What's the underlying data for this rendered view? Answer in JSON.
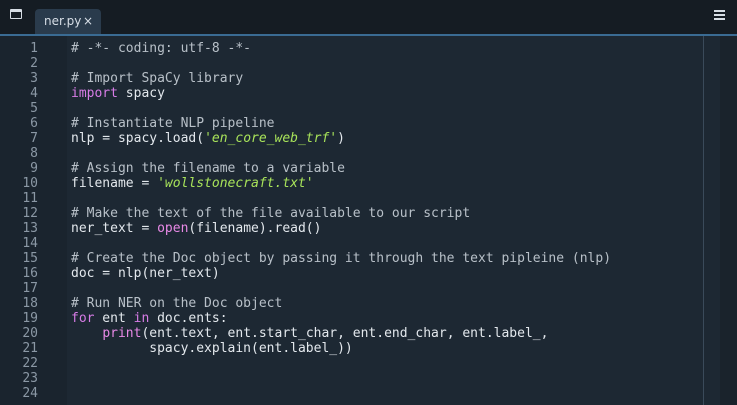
{
  "tab": {
    "filename": "ner.py",
    "close_glyph": "×"
  },
  "icons": {
    "window": "window-icon",
    "menu": "hamburger-menu-icon",
    "close": "close-icon"
  },
  "colors": {
    "background": "#1d2833",
    "comment": "#b8c0c8",
    "keyword": "#d77ce6",
    "string": "#a8e35a",
    "accent": "#3a6b93"
  },
  "line_numbers": [
    "1",
    "2",
    "3",
    "4",
    "5",
    "6",
    "7",
    "8",
    "9",
    "10",
    "11",
    "12",
    "13",
    "14",
    "15",
    "16",
    "17",
    "18",
    "19",
    "20",
    "21",
    "22",
    "23",
    "24"
  ],
  "code": {
    "l1": "# -*- coding: utf-8 -*-",
    "l3": "# Import SpaCy library",
    "l4_kw": "import",
    "l4_rest": " spacy",
    "l6": "# Instantiate NLP pipeline",
    "l7_a": "nlp = spacy.load(",
    "l7_str": "'en_core_web_trf'",
    "l7_b": ")",
    "l9": "# Assign the filename to a variable",
    "l10_a": "filename = ",
    "l10_str": "'wollstonecraft.txt'",
    "l12": "# Make the text of the file available to our script",
    "l13_a": "ner_text = ",
    "l13_fn": "open",
    "l13_b": "(filename).read()",
    "l15": "# Create the Doc object by passing it through the text pipleine (nlp)",
    "l16": "doc = nlp(ner_text)",
    "l18": "# Run NER on the Doc object",
    "l19_kw1": "for",
    "l19_a": " ent ",
    "l19_kw2": "in",
    "l19_b": " doc.ents:",
    "l20_indent": "    ",
    "l20_fn": "print",
    "l20_rest": "(ent.text, ent.start_char, ent.end_char, ent.label_,",
    "l21": "          spacy.explain(ent.label_))"
  }
}
